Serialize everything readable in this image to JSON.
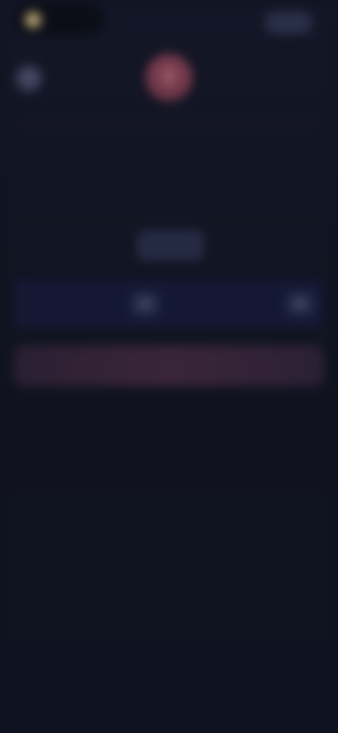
{
  "topbar": {
    "brand_glyph": "◆",
    "brand_name": "",
    "action_label": ""
  },
  "hero": {
    "back_glyph": "‹",
    "badge_glyph": "!",
    "kicker": "",
    "title": "",
    "description": ""
  },
  "center_chip": {
    "label": ""
  },
  "row": {
    "left_label": "",
    "control_a_glyph": "⇄",
    "right_label": "",
    "control_b_glyph": "⇄"
  },
  "cta": {
    "label": ""
  },
  "colors": {
    "background": "#10131f",
    "accent": "#8d4a5c",
    "panel": "#141833",
    "chip": "#252a43"
  },
  "icons": {
    "brand": "brand-logo-icon",
    "back": "back-arrow-icon",
    "hero": "alert-icon",
    "control_a": "toggle-icon",
    "control_b": "toggle-icon"
  }
}
